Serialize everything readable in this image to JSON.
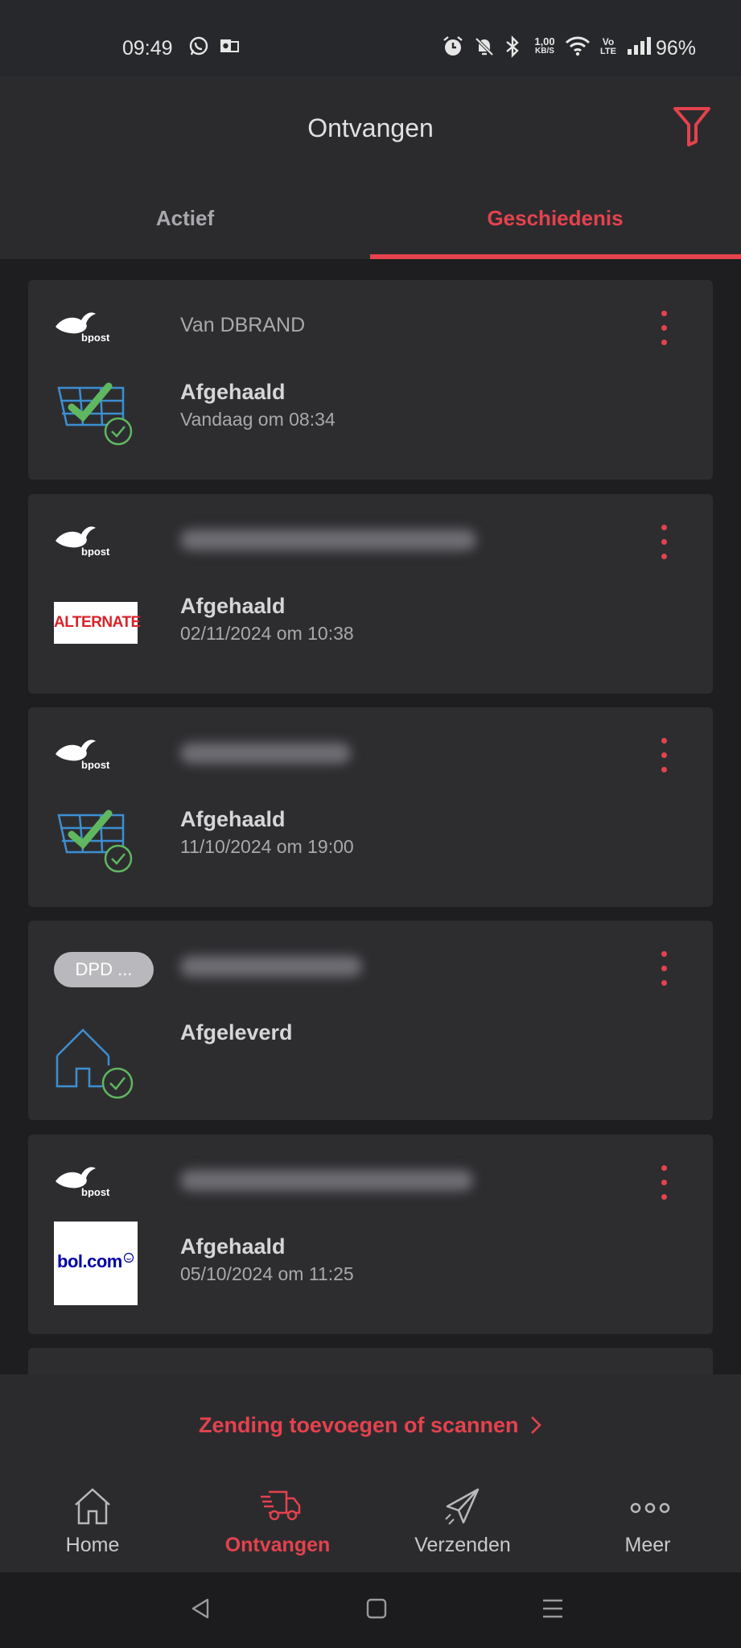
{
  "status_bar": {
    "time": "09:49",
    "net_speed_top": "1,00",
    "net_speed_bottom": "KB/S",
    "volte_top": "Vo",
    "volte_bottom": "LTE",
    "battery": "96%"
  },
  "header": {
    "title": "Ontvangen",
    "filter_icon": "filter-icon"
  },
  "tabs": [
    {
      "label": "Actief",
      "active": false
    },
    {
      "label": "Geschiedenis",
      "active": true
    }
  ],
  "shipments": [
    {
      "carrier": "bpost",
      "sender": "Van DBRAND",
      "thumbnail": "pickup-point-check-icon",
      "status": "Afgehaald",
      "date": "Vandaag om 08:34"
    },
    {
      "carrier": "bpost",
      "sender_blurred": true,
      "thumbnail": "ALTERNATE",
      "status": "Afgehaald",
      "date": "02/11/2024 om 10:38"
    },
    {
      "carrier": "bpost",
      "sender_blurred": true,
      "thumbnail": "pickup-point-check-icon",
      "status": "Afgehaald",
      "date": "11/10/2024 om 19:00"
    },
    {
      "carrier": "DPD ...",
      "sender_blurred": true,
      "thumbnail": "house-check-icon",
      "status": "Afgeleverd",
      "date": ""
    },
    {
      "carrier": "bpost",
      "sender_blurred": true,
      "thumbnail": "bol.com",
      "status": "Afgehaald",
      "date": "05/10/2024 om 11:25"
    }
  ],
  "add_link": {
    "label": "Zending toevoegen of scannen"
  },
  "bottom_nav": [
    {
      "label": "Home",
      "icon": "home-icon",
      "active": false
    },
    {
      "label": "Ontvangen",
      "icon": "truck-icon",
      "active": true
    },
    {
      "label": "Verzenden",
      "icon": "paper-plane-icon",
      "active": false
    },
    {
      "label": "Meer",
      "icon": "more-icon",
      "active": false
    }
  ],
  "colors": {
    "accent": "#e5424d",
    "card": "#2d2d30",
    "background": "#1e1e20",
    "check_green": "#5fb760",
    "icon_blue": "#3d8fd1"
  }
}
